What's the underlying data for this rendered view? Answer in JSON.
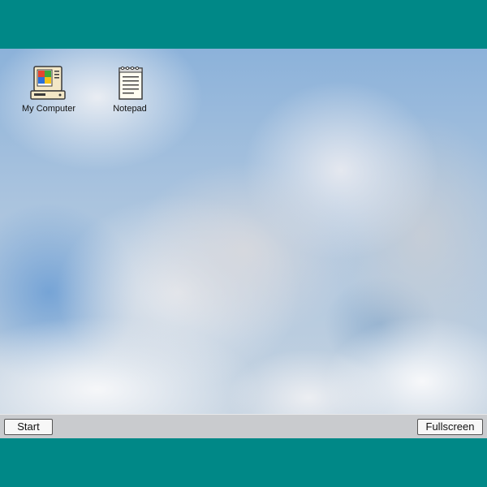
{
  "desktop": {
    "icons": [
      {
        "label": "My Computer",
        "icon": "my-computer-icon"
      },
      {
        "label": "Notepad",
        "icon": "notepad-icon"
      }
    ]
  },
  "taskbar": {
    "start_label": "Start",
    "fullscreen_label": "Fullscreen"
  },
  "colors": {
    "page_background": "#008887",
    "taskbar": "#c9cbce",
    "sky": "#8cb2da"
  }
}
